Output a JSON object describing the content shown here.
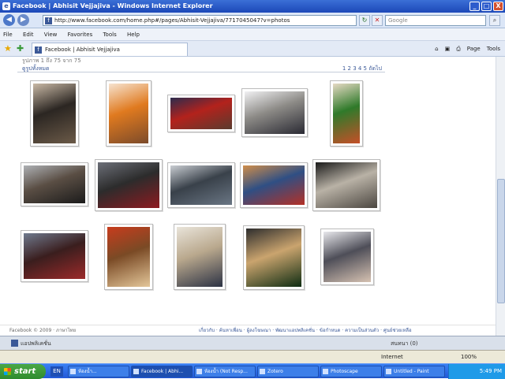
{
  "window": {
    "title": "Facebook | Abhisit Vejjajiva - Windows Internet Explorer",
    "app_icon": "internet-explorer-icon",
    "buttons": [
      "_",
      "□",
      "X"
    ]
  },
  "address_bar": {
    "url": "http://www.facebook.com/home.php#/pages/Abhisit-Vejjajiva/7717045047?v=photos",
    "search_placeholder": "Google"
  },
  "menu": [
    "File",
    "Edit",
    "View",
    "Favorites",
    "Tools",
    "Help"
  ],
  "tab": {
    "label": "Facebook | Abhisit Vejjajiva"
  },
  "toolbar": {
    "page_label": "Page",
    "tools_label": "Tools"
  },
  "content": {
    "cut_text": "รูปภาพ 1 ถึง 75 จาก 75",
    "view_all": "ดูรูปทั้งหมด",
    "pager": "1 2 3 4 5 ถัดไป"
  },
  "photos": [
    {
      "id": "photo-1",
      "colors": [
        "#6b5a48",
        "#2b2622",
        "#c9b9a6"
      ]
    },
    {
      "id": "photo-2",
      "colors": [
        "#7c4b2a",
        "#e07a1f",
        "#f6e3cf"
      ]
    },
    {
      "id": "photo-3",
      "colors": [
        "#5a3b2e",
        "#b3221c",
        "#2c2c4e"
      ]
    },
    {
      "id": "photo-4",
      "colors": [
        "#2a2a33",
        "#8c8a86",
        "#f1f1f3"
      ]
    },
    {
      "id": "photo-5",
      "colors": [
        "#c64f28",
        "#2f7a2a",
        "#e6dac4"
      ]
    },
    {
      "id": "photo-6",
      "colors": [
        "#1b1b1b",
        "#5a4e44",
        "#aeb1b5"
      ]
    },
    {
      "id": "photo-7",
      "colors": [
        "#8e1a20",
        "#2c2c2c",
        "#6c6f78"
      ]
    },
    {
      "id": "photo-8",
      "colors": [
        "#6a7684",
        "#39414a",
        "#c9cdd2"
      ]
    },
    {
      "id": "photo-9",
      "colors": [
        "#b43026",
        "#2f4f84",
        "#d08e4a"
      ]
    },
    {
      "id": "photo-10",
      "colors": [
        "#4b4640",
        "#b9b2a6",
        "#1a1a1a"
      ]
    },
    {
      "id": "photo-11",
      "colors": [
        "#9c2a2a",
        "#3a1e1e",
        "#6f7a8e"
      ]
    },
    {
      "id": "photo-12",
      "colors": [
        "#e4c79a",
        "#7a4a25",
        "#c83c1d"
      ]
    },
    {
      "id": "photo-13",
      "colors": [
        "#2c3244",
        "#b9a88d",
        "#e9e4da"
      ]
    },
    {
      "id": "photo-14",
      "colors": [
        "#0e2c12",
        "#caa46e",
        "#2d2d2d"
      ]
    },
    {
      "id": "photo-15",
      "colors": [
        "#d6c2b2",
        "#4e4e58",
        "#e8e8ec"
      ]
    }
  ],
  "footer": {
    "copyright": "Facebook © 2009 · ภาษาไทย",
    "links": "เกี่ยวกับ · ค้นหาเพื่อน · ผู้ลงโฆษณา · พัฒนาแอปพลิเคชั่น · ข้อกำหนด · ความเป็นส่วนตัว · ศูนย์ช่วยเหลือ"
  },
  "chatbar": {
    "applications": "แอปพลิเคชั่น",
    "online": "สนทนา (0)"
  },
  "status": {
    "zone": "Internet",
    "zoom": "100%"
  },
  "taskbar": {
    "start": "start",
    "lang": "EN",
    "tasks": [
      "ห้องน้ำ...",
      "Facebook | Abhi...",
      "ห้องน้ำ (Not Resp...",
      "Zotero",
      "Photoscape",
      "Untitled - Paint"
    ],
    "clock": "5:49 PM"
  }
}
